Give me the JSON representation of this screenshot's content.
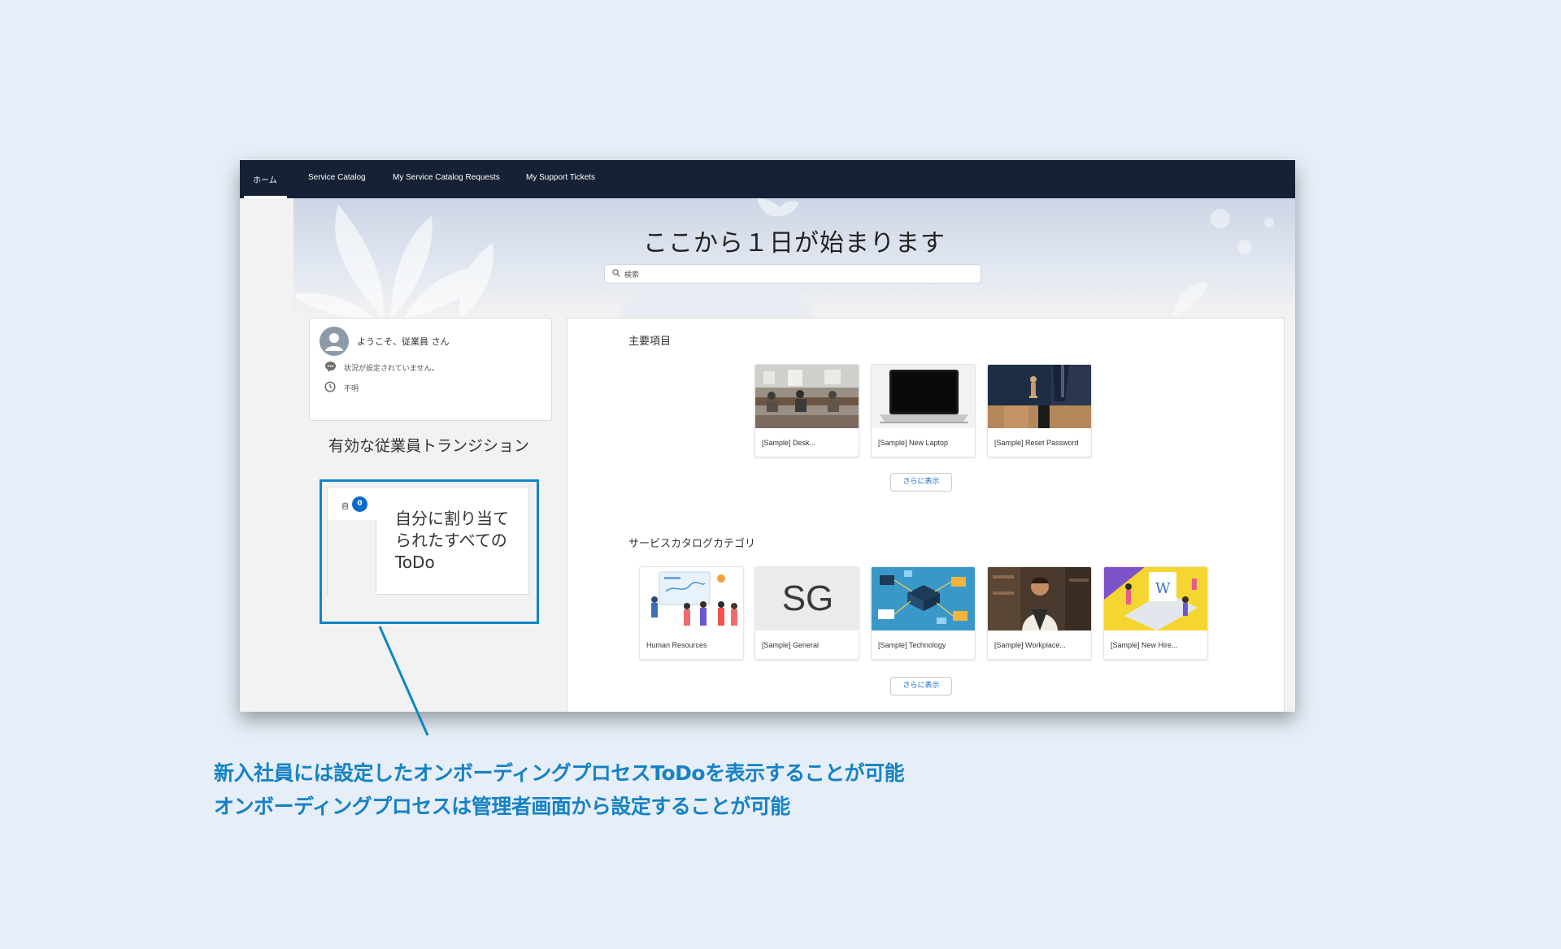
{
  "nav": {
    "items": [
      "ホーム",
      "Service Catalog",
      "My Service Catalog Requests",
      "My Support Tickets"
    ]
  },
  "hero": {
    "title": "ここから１日が始まります",
    "search_placeholder": "検索"
  },
  "profile": {
    "welcome": "ようこそ、従業員 さん",
    "status": "状況が設定されていません。",
    "time": "不明"
  },
  "transitions": {
    "title": "有効な従業員トランジション",
    "todo_short_label": "自",
    "todo_badge": "0",
    "todo_text": "自分に割り当てられたすべての ToDo"
  },
  "featured": {
    "title": "主要項目",
    "items": [
      "[Sample] Desk...",
      "[Sample] New Laptop",
      "[Sample] Reset Password"
    ],
    "more_label": "さらに表示"
  },
  "categories": {
    "title": "サービスカタログカテゴリ",
    "items": [
      "Human Resources",
      "[Sample] General",
      "[Sample] Technology",
      "[Sample] Workplace...",
      "[Sample] New Hire..."
    ],
    "general_initials": "SG",
    "more_label": "さらに表示"
  },
  "captions": [
    "新入社員には設定したオンボーディングプロセスToDoを表示することが可能",
    "オンボーディングプロセスは管理者画面から設定することが可能"
  ],
  "colors": {
    "nav_bg": "#172136",
    "highlight": "#0f86c4",
    "caption": "#1782c3",
    "badge": "#0b6bcb"
  }
}
